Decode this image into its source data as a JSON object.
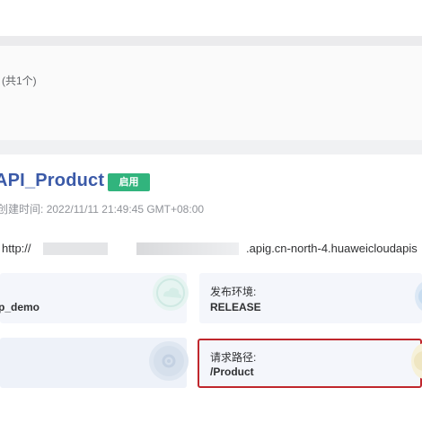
{
  "list": {
    "count_label": "(共1个)"
  },
  "api": {
    "name": "API_Product",
    "status_badge": "启用",
    "created_label": "创建时间:",
    "created_value": "2022/11/11 21:49:45 GMT+08:00"
  },
  "url": {
    "prefix": "http://",
    "suffix": ".apig.cn-north-4.huaweicloudapis"
  },
  "cards": [
    {
      "label": "",
      "value": "p_demo"
    },
    {
      "label": "发布环境:",
      "value": "RELEASE"
    },
    {
      "label": "",
      "value": ""
    },
    {
      "label": "请求路径:",
      "value": "/Product"
    }
  ],
  "icons": {
    "card1": "cloud-deco-icon",
    "card2": "env-deco-icon",
    "card3": "path-deco-icon",
    "card4": "route-deco-icon"
  },
  "colors": {
    "api_name": "#3b5aa8",
    "badge_bg": "#31b47d",
    "highlight_border": "#c0272d",
    "card_bg": "#f4f6fb"
  }
}
